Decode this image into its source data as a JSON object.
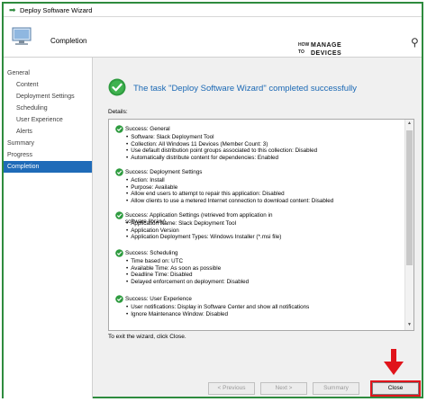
{
  "window": {
    "title": "Deploy Software Wizard"
  },
  "header": {
    "title": "Completion"
  },
  "logo": {
    "line1": "HOW",
    "line2": "TO",
    "line3": "MANAGE",
    "line4": "DEVICES"
  },
  "sidebar": {
    "items": [
      {
        "label": "General",
        "indent": false
      },
      {
        "label": "Content",
        "indent": true
      },
      {
        "label": "Deployment Settings",
        "indent": true
      },
      {
        "label": "Scheduling",
        "indent": true
      },
      {
        "label": "User Experience",
        "indent": true
      },
      {
        "label": "Alerts",
        "indent": true
      },
      {
        "label": "Summary",
        "indent": false
      },
      {
        "label": "Progress",
        "indent": false
      },
      {
        "label": "Completion",
        "indent": false,
        "selected": true
      }
    ]
  },
  "main": {
    "success_message": "The task \"Deploy Software Wizard\" completed successfully",
    "details_label": "Details:",
    "sections": [
      {
        "title": "Success: General",
        "bullets": [
          "Software: Slack Deployment Tool",
          "Collection: All Windows 11 Devices (Member Count: 3)",
          "Use default distribution point groups associated to this collection: Disabled",
          "Automatically distribute content for dependencies: Enabled"
        ]
      },
      {
        "title": "Success: Deployment Settings",
        "bullets": [
          "Action: Install",
          "Purpose: Available",
          "Allow end users to attempt to repair this application: Disabled",
          "Allow clients to use a metered Internet connection to download content: Disabled"
        ]
      },
      {
        "title": "Success: Application Settings (retrieved from application in software library)",
        "bullets": [
          "Application Name: Slack Deployment Tool",
          "Application Version",
          "Application Deployment Types: Windows Installer (*.msi file)"
        ]
      },
      {
        "title": "Success: Scheduling",
        "bullets": [
          "Time based on: UTC",
          "Available Time: As soon as possible",
          "Deadline Time: Disabled",
          "Delayed enforcement on deployment: Disabled"
        ]
      },
      {
        "title": "Success: User Experience",
        "bullets": [
          "User notifications: Display in Software Center and show all notifications",
          "Ignore Maintenance Window: Disabled"
        ]
      }
    ],
    "exit_text": "To exit the wizard, click Close."
  },
  "buttons": {
    "previous": "< Previous",
    "next": "Next >",
    "summary": "Summary",
    "close": "Close"
  },
  "colors": {
    "accent": "#1f6bb8",
    "success": "#2e9b3f",
    "highlight": "#e0141b"
  }
}
